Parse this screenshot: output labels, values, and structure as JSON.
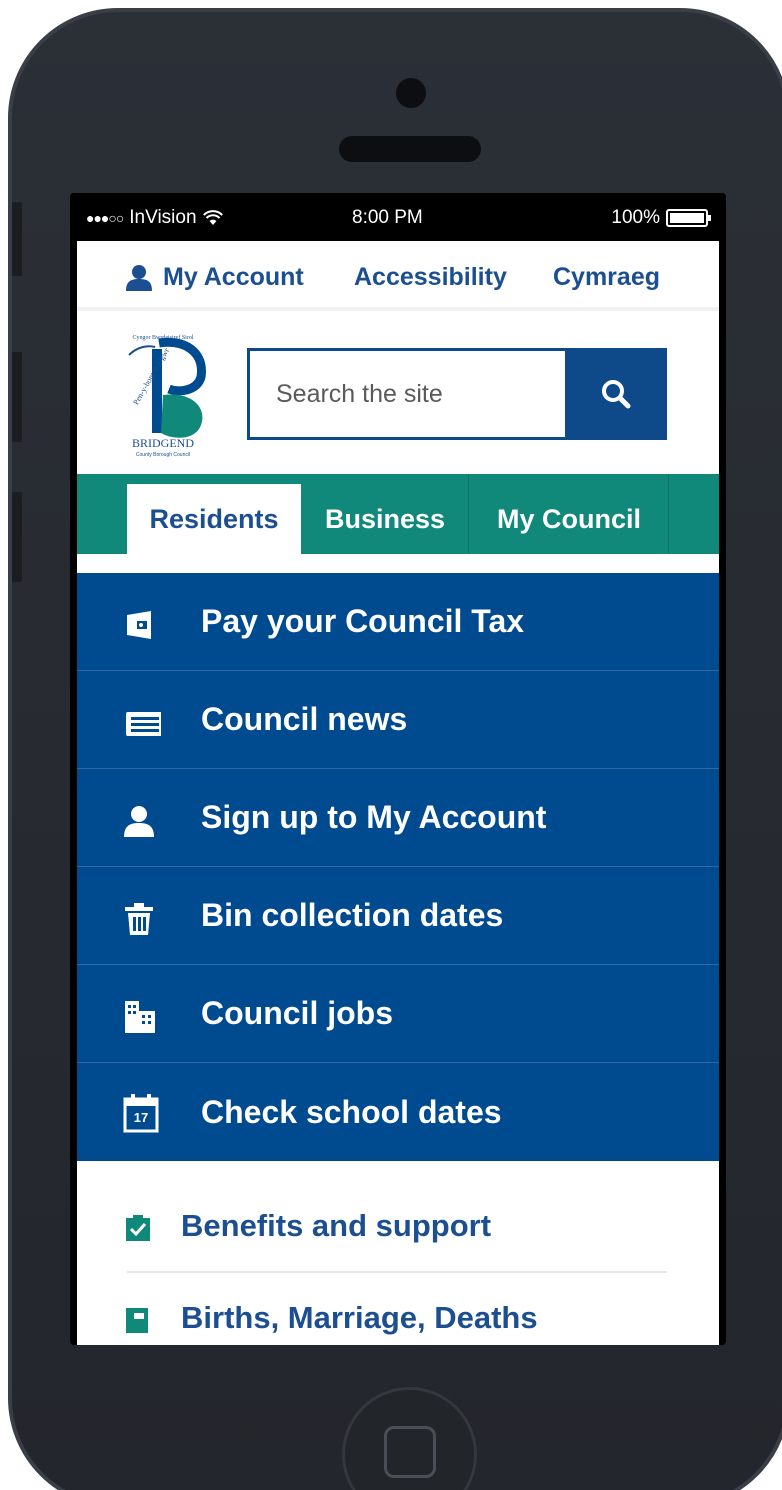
{
  "status_bar": {
    "carrier": "InVision",
    "time": "8:00 PM",
    "battery": "100%"
  },
  "top_nav": {
    "my_account": "My Account",
    "accessibility": "Accessibility",
    "language": "Cymraeg"
  },
  "search": {
    "placeholder": "Search the site"
  },
  "tabs": [
    {
      "label": "Residents"
    },
    {
      "label": "Business"
    },
    {
      "label": "My Council"
    }
  ],
  "quick_links": [
    {
      "label": "Pay your Council Tax",
      "icon": "wallet-icon"
    },
    {
      "label": "Council news",
      "icon": "newspaper-icon"
    },
    {
      "label": "Sign up to My Account",
      "icon": "user-icon"
    },
    {
      "label": "Bin collection dates",
      "icon": "trash-icon"
    },
    {
      "label": "Council jobs",
      "icon": "building-icon"
    },
    {
      "label": "Check school dates",
      "icon": "calendar-icon",
      "calendar_day": "17"
    }
  ],
  "topic_links": [
    {
      "label": "Benefits and support",
      "icon": "clipboard-check-icon"
    },
    {
      "label": "Births, Marriage, Deaths",
      "icon": "book-icon"
    }
  ],
  "colors": {
    "brand_blue": "#004a8f",
    "link_blue": "#1b4f91",
    "tab_teal": "#10897a"
  }
}
